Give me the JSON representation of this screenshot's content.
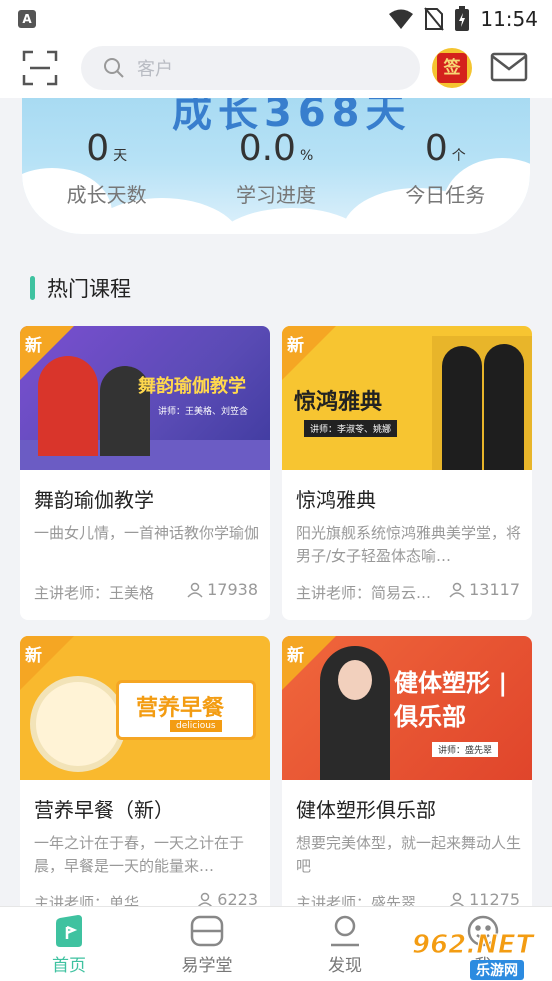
{
  "status_bar": {
    "time": "11:54",
    "app_badge": "A"
  },
  "top_bar": {
    "search_placeholder": "客户",
    "checkin_label": "签"
  },
  "banner": {
    "title_art": "成长368天",
    "stats": [
      {
        "value": "0",
        "unit": "天",
        "label": "成长天数"
      },
      {
        "value": "0.0",
        "unit": "%",
        "label": "学习进度"
      },
      {
        "value": "0",
        "unit": "个",
        "label": "今日任务"
      }
    ]
  },
  "section": {
    "title": "热门课程"
  },
  "courses": [
    {
      "name": "舞韵瑜伽教学",
      "desc": "一曲女儿情，一首神话教你学瑜伽",
      "teacher": "主讲老师：王美格",
      "count": "17938",
      "thumb_title": "舞韵瑜伽教学",
      "thumb_sub": "讲师：王美格、刘笠含",
      "badge": "新",
      "bg": "#5a4bb5"
    },
    {
      "name": "惊鸿雅典",
      "desc": "阳光旗舰系统惊鸿雅典美学堂，将男子/女子轻盈体态喻…",
      "teacher": "主讲老师：简易云学…",
      "count": "13117",
      "thumb_title": "惊鸿雅典",
      "thumb_sub": "讲师：李淑苓、姚娜",
      "badge": "新",
      "bg": "#f7c531"
    },
    {
      "name": "营养早餐（新）",
      "desc": "一年之计在于春，一天之计在于晨，早餐是一天的能量来…",
      "teacher": "主讲老师：单华",
      "count": "6223",
      "thumb_title": "营养早餐",
      "thumb_sub": "delicious",
      "badge": "新",
      "bg": "#f9b92e"
    },
    {
      "name": "健体塑形俱乐部",
      "desc": "想要完美体型，就一起来舞动人生吧",
      "teacher": "主讲老师：盛先翠",
      "count": "11275",
      "thumb_title": "健体塑形 | 俱乐部",
      "thumb_sub": "讲师：盛先翠",
      "badge": "新",
      "bg": "#e0452b"
    }
  ],
  "bottom_nav": [
    {
      "label": "首页",
      "icon": "home-icon",
      "active": true
    },
    {
      "label": "易学堂",
      "icon": "layers-icon",
      "active": false
    },
    {
      "label": "发现",
      "icon": "user-icon",
      "active": false
    },
    {
      "label": "我",
      "icon": "smile-icon",
      "active": false
    }
  ],
  "watermark": {
    "text": "962.NET",
    "sub": "乐游网"
  },
  "colors": {
    "accent": "#3fc2a0",
    "new_badge": "#f5a623"
  }
}
